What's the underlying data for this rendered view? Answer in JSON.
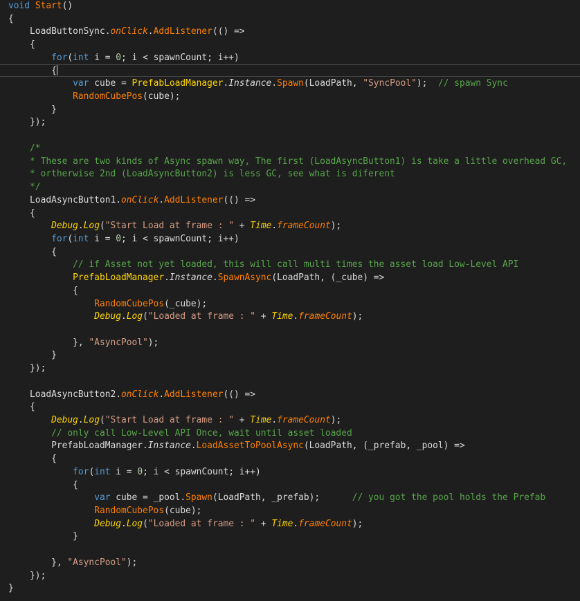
{
  "editor": {
    "background": "#1e1e1e",
    "colors": {
      "keyword": "#569cd6",
      "method": "#ff8000",
      "string": "#d69d85",
      "number": "#b5cea8",
      "comment": "#57a64a",
      "identifier": "#dcdcdc",
      "class": "#ffd700",
      "current_line_border": "#464646"
    },
    "cursor": {
      "line": 6,
      "column": 9
    },
    "lines": [
      [
        [
          "k",
          "void"
        ],
        [
          "p",
          " "
        ],
        [
          "m",
          "Start"
        ],
        [
          "p",
          "()"
        ]
      ],
      [
        [
          "p",
          "{"
        ]
      ],
      [
        [
          "p",
          "    "
        ],
        [
          "i",
          "LoadButtonSync"
        ],
        [
          "p",
          "."
        ],
        [
          "pi",
          "onClick"
        ],
        [
          "p",
          "."
        ],
        [
          "m",
          "AddListener"
        ],
        [
          "p",
          "(() =>"
        ]
      ],
      [
        [
          "p",
          "    {"
        ]
      ],
      [
        [
          "p",
          "        "
        ],
        [
          "k",
          "for"
        ],
        [
          "p",
          "("
        ],
        [
          "k",
          "int"
        ],
        [
          "p",
          " i = "
        ],
        [
          "n",
          "0"
        ],
        [
          "p",
          "; i < spawnCount; i++)"
        ]
      ],
      [
        [
          "p",
          "        {"
        ]
      ],
      [],
      [
        [
          "p",
          "            "
        ],
        [
          "k",
          "var"
        ],
        [
          "p",
          " cube = "
        ],
        [
          "c",
          "PrefabLoadManager"
        ],
        [
          "p",
          "."
        ],
        [
          "ti",
          "Instance"
        ],
        [
          "p",
          "."
        ],
        [
          "m",
          "Spawn"
        ],
        [
          "p",
          "(LoadPath, "
        ],
        [
          "s",
          "\"SyncPool\""
        ],
        [
          "p",
          ");  "
        ],
        [
          "cm",
          "// spawn Sync"
        ]
      ],
      [
        [
          "p",
          "            "
        ],
        [
          "m",
          "RandomCubePos"
        ],
        [
          "p",
          "(cube);"
        ]
      ],
      [
        [
          "p",
          "        }"
        ]
      ],
      [
        [
          "p",
          "    });"
        ]
      ],
      [],
      [
        [
          "p",
          "    "
        ],
        [
          "cm",
          "/*"
        ]
      ],
      [
        [
          "p",
          "    "
        ],
        [
          "cm",
          "* These are two kinds of Async spawn way, The first (LoadAsyncButton1) is take a little overhead GC,"
        ]
      ],
      [
        [
          "p",
          "    "
        ],
        [
          "cm",
          "* ortherwise 2nd (LoadAsyncButton2) is less GC, see what is diferent"
        ]
      ],
      [
        [
          "p",
          "    "
        ],
        [
          "cm",
          "*/"
        ]
      ],
      [
        [
          "p",
          "    "
        ],
        [
          "i",
          "LoadAsyncButton1"
        ],
        [
          "p",
          "."
        ],
        [
          "pi",
          "onClick"
        ],
        [
          "p",
          "."
        ],
        [
          "m",
          "AddListener"
        ],
        [
          "p",
          "(() =>"
        ]
      ],
      [
        [
          "p",
          "    {"
        ]
      ],
      [
        [
          "p",
          "        "
        ],
        [
          "ci",
          "Debug"
        ],
        [
          "p",
          "."
        ],
        [
          "ci",
          "Log"
        ],
        [
          "p",
          "("
        ],
        [
          "s",
          "\"Start Load at frame : \""
        ],
        [
          "p",
          " + "
        ],
        [
          "ci",
          "Time"
        ],
        [
          "p",
          "."
        ],
        [
          "pi",
          "frameCount"
        ],
        [
          "p",
          ");"
        ]
      ],
      [
        [
          "p",
          "        "
        ],
        [
          "k",
          "for"
        ],
        [
          "p",
          "("
        ],
        [
          "k",
          "int"
        ],
        [
          "p",
          " i = "
        ],
        [
          "n",
          "0"
        ],
        [
          "p",
          "; i < spawnCount; i++)"
        ]
      ],
      [
        [
          "p",
          "        {"
        ]
      ],
      [
        [
          "p",
          "            "
        ],
        [
          "cm",
          "// if Asset not yet loaded, this will call multi times the asset load Low-Level API"
        ]
      ],
      [
        [
          "p",
          "            "
        ],
        [
          "c",
          "PrefabLoadManager"
        ],
        [
          "p",
          "."
        ],
        [
          "ti",
          "Instance"
        ],
        [
          "p",
          "."
        ],
        [
          "m",
          "SpawnAsync"
        ],
        [
          "p",
          "(LoadPath, (_cube) =>"
        ]
      ],
      [
        [
          "p",
          "            {"
        ]
      ],
      [
        [
          "p",
          "                "
        ],
        [
          "m",
          "RandomCubePos"
        ],
        [
          "p",
          "(_cube);"
        ]
      ],
      [
        [
          "p",
          "                "
        ],
        [
          "ci",
          "Debug"
        ],
        [
          "p",
          "."
        ],
        [
          "ci",
          "Log"
        ],
        [
          "p",
          "("
        ],
        [
          "s",
          "\"Loaded at frame : \""
        ],
        [
          "p",
          " + "
        ],
        [
          "ci",
          "Time"
        ],
        [
          "p",
          "."
        ],
        [
          "pi",
          "frameCount"
        ],
        [
          "p",
          ");"
        ]
      ],
      [],
      [
        [
          "p",
          "            }, "
        ],
        [
          "s",
          "\"AsyncPool\""
        ],
        [
          "p",
          ");"
        ]
      ],
      [
        [
          "p",
          "        }"
        ]
      ],
      [
        [
          "p",
          "    });"
        ]
      ],
      [],
      [
        [
          "p",
          "    "
        ],
        [
          "i",
          "LoadAsyncButton2"
        ],
        [
          "p",
          "."
        ],
        [
          "pi",
          "onClick"
        ],
        [
          "p",
          "."
        ],
        [
          "m",
          "AddListener"
        ],
        [
          "p",
          "(() =>"
        ]
      ],
      [
        [
          "p",
          "    {"
        ]
      ],
      [
        [
          "p",
          "        "
        ],
        [
          "ci",
          "Debug"
        ],
        [
          "p",
          "."
        ],
        [
          "ci",
          "Log"
        ],
        [
          "p",
          "("
        ],
        [
          "s",
          "\"Start Load at frame : \""
        ],
        [
          "p",
          " + "
        ],
        [
          "ci",
          "Time"
        ],
        [
          "p",
          "."
        ],
        [
          "pi",
          "frameCount"
        ],
        [
          "p",
          ");"
        ]
      ],
      [
        [
          "p",
          "        "
        ],
        [
          "cm",
          "// only call Low-Level API Once, wait until asset loaded"
        ]
      ],
      [
        [
          "p",
          "        "
        ],
        [
          "i",
          "PrefabLoadManager"
        ],
        [
          "p",
          "."
        ],
        [
          "ti",
          "Instance"
        ],
        [
          "p",
          "."
        ],
        [
          "m",
          "LoadAssetToPoolAsync"
        ],
        [
          "p",
          "(LoadPath, (_prefab, _pool) =>"
        ]
      ],
      [
        [
          "p",
          "        {"
        ]
      ],
      [
        [
          "p",
          "            "
        ],
        [
          "k",
          "for"
        ],
        [
          "p",
          "("
        ],
        [
          "k",
          "int"
        ],
        [
          "p",
          " i = "
        ],
        [
          "n",
          "0"
        ],
        [
          "p",
          "; i < spawnCount; i++)"
        ]
      ],
      [
        [
          "p",
          "            {"
        ]
      ],
      [
        [
          "p",
          "                "
        ],
        [
          "k",
          "var"
        ],
        [
          "p",
          " cube = _pool."
        ],
        [
          "m",
          "Spawn"
        ],
        [
          "p",
          "(LoadPath, _prefab);      "
        ],
        [
          "cm",
          "// you got the pool holds the Prefab"
        ]
      ],
      [
        [
          "p",
          "                "
        ],
        [
          "m",
          "RandomCubePos"
        ],
        [
          "p",
          "(cube);"
        ]
      ],
      [
        [
          "p",
          "                "
        ],
        [
          "ci",
          "Debug"
        ],
        [
          "p",
          "."
        ],
        [
          "ci",
          "Log"
        ],
        [
          "p",
          "("
        ],
        [
          "s",
          "\"Loaded at frame : \""
        ],
        [
          "p",
          " + "
        ],
        [
          "ci",
          "Time"
        ],
        [
          "p",
          "."
        ],
        [
          "pi",
          "frameCount"
        ],
        [
          "p",
          ");"
        ]
      ],
      [
        [
          "p",
          "            }"
        ]
      ],
      [],
      [
        [
          "p",
          "        }, "
        ],
        [
          "s",
          "\"AsyncPool\""
        ],
        [
          "p",
          ");"
        ]
      ],
      [
        [
          "p",
          "    });"
        ]
      ],
      [
        [
          "p",
          "}"
        ]
      ]
    ]
  }
}
